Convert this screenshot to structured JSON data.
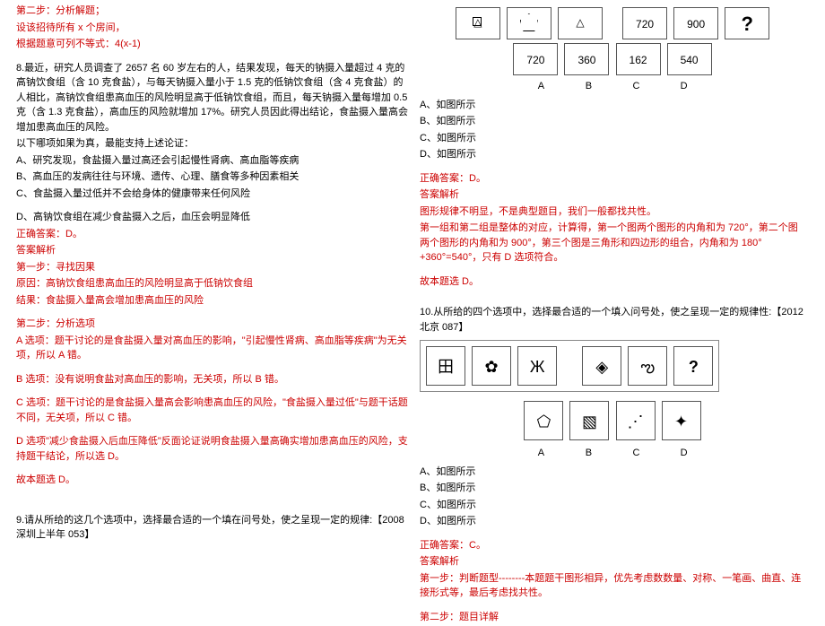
{
  "left": {
    "step2_head": "第二步：分析解题；",
    "step2_l1": "设该招待所有 x 个房间，",
    "step2_l2": "根据题意可列不等式：4(x-1)",
    "q8_text": "8.最近，研究人员调查了 2657 名 60 岁左右的人，结果发现，每天的钠摄入量超过 4 克的高钠饮食组（含 10 克食盐），与每天钠摄入量小于 1.5 克的低钠饮食组（含 4 克食盐）的人相比，高钠饮食组患高血压的风险明显高于低钠饮食组，而且，每天钠摄入量每增加 0.5 克（含 1.3 克食盐），高血压的风险就增加 17%。研究人员因此得出结论，食盐摄入量高会增加患高血压的风险。",
    "q8_text2": "以下哪项如果为真，最能支持上述论证：",
    "q8_a": "A、研究发现，食盐摄入量过高还会引起慢性肾病、高血脂等疾病",
    "q8_b": "B、高血压的发病往往与环境、遗传、心理、膳食等多种因素相关",
    "q8_c": "C、食盐摄入量过低并不会给身体的健康带来任何风险",
    "q8_d": "D、高钠饮食组在减少食盐摄入之后，血压会明显降低",
    "q8_ans": "正确答案：D。",
    "q8_jiexi": "答案解析",
    "q8_step1": "第一步：寻找因果",
    "q8_cause": "原因：高钠饮食组患高血压的风险明显高于低钠饮食组",
    "q8_result": "结果：食盐摄入量高会增加患高血压的风险",
    "q8_step2h": "第二步：分析选项",
    "q8_expA": "A 选项：题干讨论的是食盐摄入量对高血压的影响，\"引起慢性肾病、高血脂等疾病\"为无关项，所以 A 错。",
    "q8_expB": "B 选项：没有说明食盐对高血压的影响，无关项，所以 B 错。",
    "q8_expC": "C 选项：题干讨论的是食盐摄入量高会影响患高血压的风险，\"食盐摄入量过低\"与题干话题不同，无关项，所以 C 错。",
    "q8_expD": "D 选项\"减少食盐摄入后血压降低\"反面论证说明食盐摄入量高确实增加患高血压的风险，支持题干结论，所以选 D。",
    "q8_so": "故本题选 D。",
    "q9_text": "9.请从所给的这几个选项中，选择最合适的一个填在问号处，使之呈现一定的规律:【2008 深圳上半年 053】"
  },
  "right": {
    "row1": {
      "n1": "720",
      "n2": "900",
      "q": "?"
    },
    "row2": {
      "a": "720",
      "b": "360",
      "c": "162",
      "d": "540"
    },
    "lblA": "A",
    "lblB": "B",
    "lblC": "C",
    "lblD": "D",
    "optA": "A、如图所示",
    "optB": "B、如图所示",
    "optC": "C、如图所示",
    "optD": "D、如图所示",
    "ans9": "正确答案：D。",
    "jiexi9": "答案解析",
    "exp9_1": "图形规律不明显，不是典型题目，我们一般都找共性。",
    "exp9_2": "第一组和第二组是整体的对应，计算得，第一个图两个图形的内角和为 720°，第二个图两个图形的内角和为 900°，第三个图是三角形和四边形的组合，内角和为 180°+360°=540°，只有 D 选项符合。",
    "exp9_so": "故本题选 D。",
    "q10_text": "10.从所给的四个选项中，选择最合适的一个填入问号处，使之呈现一定的规律性:【2012 北京 087】",
    "q10_optA": "A、如图所示",
    "q10_optB": "B、如图所示",
    "q10_optC": "C、如图所示",
    "q10_optD": "D、如图所示",
    "ans10": "正确答案：C。",
    "jiexi10": "答案解析",
    "exp10_1": "第一步：判断题型--------本题题干图形相异，优先考虑数数量、对称、一笔画、曲直、连接形式等，最后考虑找共性。",
    "exp10_2": "第二步：题目详解"
  }
}
